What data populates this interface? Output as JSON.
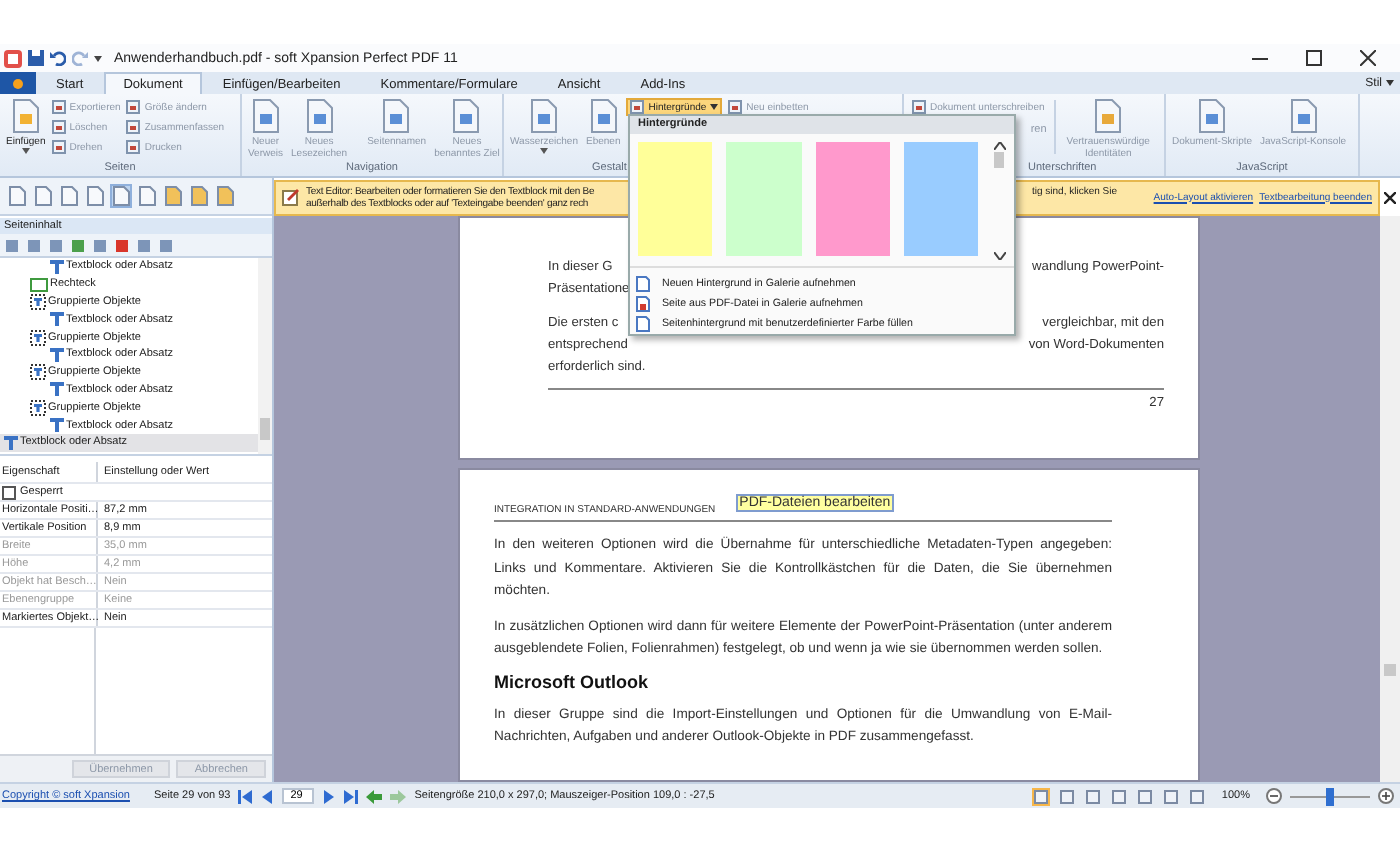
{
  "window": {
    "title": "Anwenderhandbuch.pdf - soft Xpansion Perfect PDF 11"
  },
  "tabs": [
    {
      "label": "Start",
      "selected": false
    },
    {
      "label": "Dokument",
      "selected": true
    },
    {
      "label": "Einfügen/Bearbeiten",
      "selected": false
    },
    {
      "label": "Kommentare/Formulare",
      "selected": false
    },
    {
      "label": "Ansicht",
      "selected": false
    },
    {
      "label": "Add-Ins",
      "selected": false
    }
  ],
  "style_menu": {
    "label": "Stil"
  },
  "ribbon": {
    "groups": [
      {
        "label": "Seiten",
        "items": [
          {
            "kind": "large",
            "label": "Einfügen",
            "disabled": false,
            "dropdown": true
          },
          {
            "kind": "column",
            "items": [
              {
                "label": "Exportieren",
                "disabled": true,
                "open": false
              },
              {
                "label": "Löschen",
                "disabled": true,
                "open": false
              },
              {
                "label": "Drehen",
                "disabled": true,
                "open": false
              }
            ]
          },
          {
            "kind": "column",
            "items": [
              {
                "label": "Größe ändern",
                "disabled": true,
                "open": false
              },
              {
                "label": "Zusammenfassen",
                "disabled": true,
                "open": false
              },
              {
                "label": "Drucken",
                "disabled": true,
                "open": false
              }
            ]
          }
        ]
      },
      {
        "label": "Navigation",
        "items": [
          {
            "kind": "large",
            "label": "Neuer\nVerweis",
            "disabled": true,
            "dropdown": false
          },
          {
            "kind": "large",
            "label": "Neues\nLesezeichen",
            "disabled": true,
            "dropdown": false
          },
          {
            "kind": "separator"
          },
          {
            "kind": "large",
            "label": "Seitennamen",
            "disabled": true,
            "dropdown": false
          },
          {
            "kind": "large",
            "label": "Neues\nbenanntes Ziel",
            "disabled": true,
            "dropdown": false
          }
        ]
      },
      {
        "label": "Gestalt",
        "items": [
          {
            "kind": "large",
            "label": "Wasserzeichen",
            "disabled": true,
            "dropdown": true
          },
          {
            "kind": "large",
            "label": "Ebenen",
            "disabled": true,
            "dropdown": false
          },
          {
            "kind": "column",
            "items": [
              {
                "label": "Hintergründe",
                "disabled": false,
                "open": true
              }
            ]
          },
          {
            "kind": "column",
            "items": [
              {
                "label": "Neu einbetten",
                "disabled": true,
                "open": false
              }
            ]
          }
        ]
      },
      {
        "label": "Unterschriften",
        "items": [
          {
            "kind": "column",
            "items": [
              {
                "label": "Dokument unterschreiben",
                "disabled": true,
                "open": false
              }
            ]
          },
          {
            "kind": "separator"
          },
          {
            "kind": "large",
            "label": "Vertrauenswürdige\nIdentitäten",
            "disabled": true,
            "dropdown": false
          }
        ]
      },
      {
        "label": "JavaScript",
        "items": [
          {
            "kind": "large",
            "label": "Dokument-Skripte",
            "disabled": true,
            "dropdown": false
          },
          {
            "kind": "large",
            "label": "JavaScript-Konsole",
            "disabled": true,
            "dropdown": false
          }
        ]
      }
    ]
  },
  "ribbon_fragment": {
    "label": "ren"
  },
  "backgrounds_menu": {
    "title": "Hintergründe",
    "swatches": [
      {
        "color": "#ffff99"
      },
      {
        "color": "#ccffcc"
      },
      {
        "color": "#ff99cc"
      },
      {
        "color": "#99ccff"
      }
    ],
    "items": [
      {
        "label": "Neuen Hintergrund in Galerie aufnehmen"
      },
      {
        "label": "Seite aus PDF-Datei in Galerie aufnehmen"
      },
      {
        "label": "Seitenhintergrund mit benutzerdefinierter Farbe füllen"
      }
    ]
  },
  "left_toolbar": [
    {
      "selected": false
    },
    {
      "selected": false
    },
    {
      "selected": false
    },
    {
      "selected": false
    },
    {
      "selected": true
    },
    {
      "selected": false
    },
    {
      "selected": false
    },
    {
      "selected": false
    },
    {
      "selected": false
    }
  ],
  "content_panel": {
    "title": "Seiteninhalt",
    "tree": {
      "partial_branch": {
        "tail_children": [
          {
            "kind": "text",
            "label": "Textblock oder Absatz",
            "selected": false
          }
        ],
        "children": [
          {
            "kind": "rect",
            "label": "Rechteck",
            "selected": false
          },
          {
            "kind": "group",
            "label": "Gruppierte Objekte",
            "selected": false,
            "children": [
              {
                "kind": "text",
                "label": "Textblock oder Absatz",
                "selected": false
              }
            ]
          },
          {
            "kind": "group",
            "label": "Gruppierte Objekte",
            "selected": false,
            "children": [
              {
                "kind": "text",
                "label": "Textblock oder Absatz",
                "selected": false
              }
            ]
          },
          {
            "kind": "group",
            "label": "Gruppierte Objekte",
            "selected": false,
            "children": [
              {
                "kind": "text",
                "label": "Textblock oder Absatz",
                "selected": false
              }
            ]
          },
          {
            "kind": "group",
            "label": "Gruppierte Objekte",
            "selected": false,
            "children": [
              {
                "kind": "text",
                "label": "Textblock oder Absatz",
                "selected": false
              }
            ]
          }
        ]
      },
      "items": [
        {
          "kind": "text",
          "label": "Textblock oder Absatz",
          "selected": true
        }
      ]
    }
  },
  "properties": {
    "columns": [
      "Eigenschaft",
      "Einstellung oder Wert"
    ],
    "locked": {
      "label": "Gesperrt",
      "checked": false
    },
    "rows": [
      {
        "name": "Horizontale Positi…",
        "value": "87,2 mm",
        "disabled": false
      },
      {
        "name": "Vertikale Position",
        "value": "8,9 mm",
        "disabled": false
      },
      {
        "name": "Breite",
        "value": "35,0 mm",
        "disabled": true
      },
      {
        "name": "Höhe",
        "value": "4,2 mm",
        "disabled": true
      },
      {
        "name": "Objekt hat Besch…",
        "value": "Nein",
        "disabled": true
      },
      {
        "name": "Ebenengruppe",
        "value": "Keine",
        "disabled": true
      },
      {
        "name": "Markiertes Objekt…",
        "value": "Nein",
        "disabled": false
      }
    ],
    "buttons": [
      {
        "label": "Übernehmen",
        "disabled": true
      },
      {
        "label": "Abbrechen",
        "disabled": true
      }
    ]
  },
  "infobar": {
    "lines": [
      "Text Editor: Bearbeiten oder formatieren Sie den Textblock mit den Be",
      "außerhalb des Textblocks oder auf 'Texteingabe beenden' ganz rech"
    ],
    "tail": "tig sind, klicken Sie",
    "links": [
      "Auto-Layout aktivieren",
      "Textbearbeitung beenden"
    ]
  },
  "page_1": {
    "rows": [
      {
        "left": "In dieser G",
        "right": "wandlung PowerPoint-"
      },
      {
        "left": "Präsentatione",
        "right": ""
      }
    ],
    "rows_2": [
      {
        "left": "Die ersten c",
        "right": "vergleichbar, mit den"
      },
      {
        "left": "entsprechend",
        "right": "von Word-Dokumenten"
      }
    ],
    "last_line": "erforderlich sind.",
    "page_number": "27"
  },
  "page_2": {
    "running_head": "INTEGRATION IN STANDARD-ANWENDUNGEN",
    "edit_box": "PDF-Dateien bearbeiten",
    "blocks": [
      {
        "kind": "paragraph",
        "text": "In den weiteren Optionen wird die Übernahme für unterschiedliche Metadaten-Typen angegeben: Links und Kommentare. Aktivieren Sie die Kontrollkästchen für die Daten, die Sie übernehmen möchten."
      },
      {
        "kind": "paragraph",
        "text": "In zusätzlichen Optionen wird dann für weitere Elemente der PowerPoint-Präsentation (unter anderem ausgeblendete Folien, Folienrahmen) festgelegt, ob und wenn ja wie sie übernommen werden sollen."
      },
      {
        "kind": "heading",
        "text": "Microsoft Outlook"
      },
      {
        "kind": "paragraph",
        "text": "In dieser Gruppe sind die Import-Einstellungen und Optionen für die Umwandlung von E-Mail-Nachrichten, Aufgaben und anderer Outlook-Objekte in PDF zusammengefasst."
      }
    ]
  },
  "status_bar": {
    "copyright": "Copyright © soft Xpansion",
    "page_info": "Seite 29 von 93",
    "page_input": "29",
    "size_info": "Seitengröße 210,0 x 297,0; Mauszeiger-Position 109,0 : -27,5",
    "view_buttons": [
      {
        "selected": true
      },
      {
        "selected": false
      },
      {
        "selected": false
      },
      {
        "selected": false
      },
      {
        "selected": false
      },
      {
        "selected": false
      },
      {
        "selected": false
      }
    ],
    "zoom": "100%",
    "zoom_slider": {
      "level": 0.5
    }
  }
}
